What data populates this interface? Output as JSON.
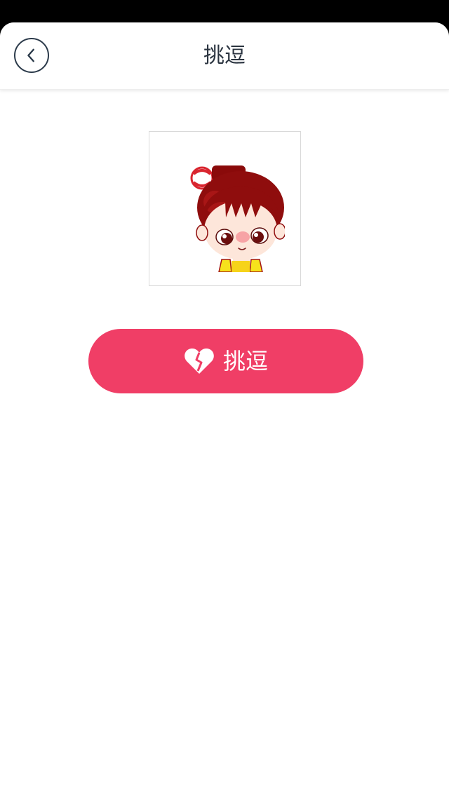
{
  "nav": {
    "title": "挑逗",
    "back_icon": "chevron-left-icon"
  },
  "sticker": {
    "description_icon": "cartoon-girl-sticker"
  },
  "action": {
    "label": "挑逗",
    "icon": "broken-heart-icon",
    "color": "#f03e66"
  }
}
